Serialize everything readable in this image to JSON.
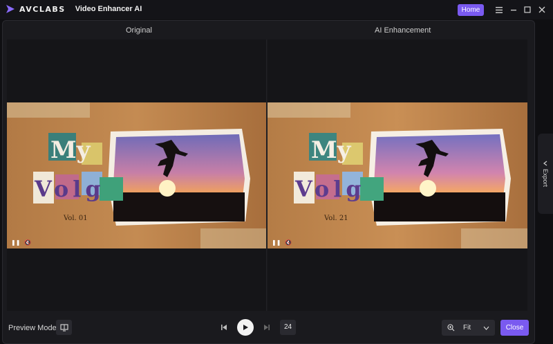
{
  "app": {
    "brand": "AVCLABS",
    "name": "Video Enhancer AI"
  },
  "titlebar": {
    "home_label": "Home"
  },
  "panels": {
    "left_title": "Original",
    "right_title": "AI Enhancement"
  },
  "video": {
    "left_vol": "Vol. 01",
    "right_vol": "Vol. 21",
    "title_line1": "My",
    "title_line2": "Volg"
  },
  "sidebar": {
    "export_label": "Export"
  },
  "footer": {
    "preview_mode_label": "Preview Mode",
    "frame_value": "24",
    "zoom_label": "Fit",
    "close_label": "Close"
  },
  "colors": {
    "accent": "#7a5af0",
    "bg": "#0f0f12"
  }
}
